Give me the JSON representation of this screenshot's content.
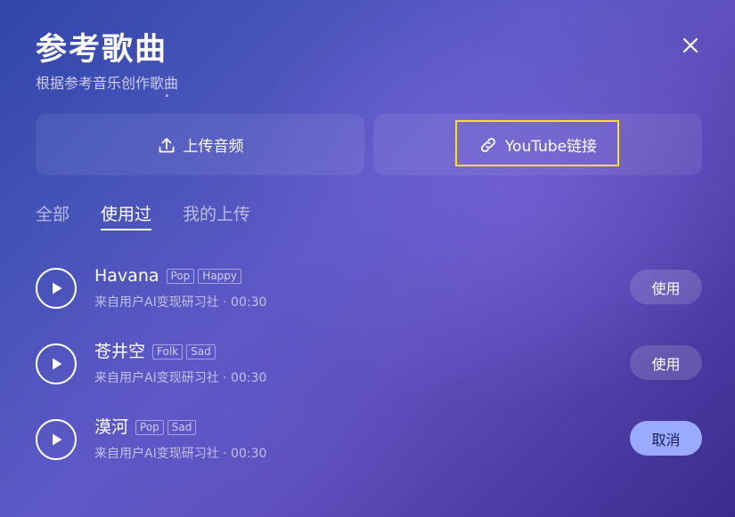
{
  "header": {
    "title": "参考歌曲",
    "subtitle": "根据参考音乐创作歌曲"
  },
  "sources": {
    "upload_label": "上传音频",
    "youtube_label": "YouTube链接"
  },
  "tabs": [
    {
      "label": "全部",
      "active": false
    },
    {
      "label": "使用过",
      "active": true
    },
    {
      "label": "我的上传",
      "active": false
    }
  ],
  "songs": [
    {
      "name": "Havana",
      "tags": [
        "Pop",
        "Happy"
      ],
      "meta": "来自用户AI变现研习社 · 00:30",
      "action": "使用"
    },
    {
      "name": "苍井空",
      "tags": [
        "Folk",
        "Sad"
      ],
      "meta": "来自用户AI变现研习社 · 00:30",
      "action": "使用"
    },
    {
      "name": "漠河",
      "tags": [
        "Pop",
        "Sad"
      ],
      "meta": "来自用户AI变现研习社 · 00:30",
      "action": "取消"
    }
  ],
  "colors": {
    "highlight_frame": "#ffe11a",
    "cancel_button": "#9aabff"
  }
}
